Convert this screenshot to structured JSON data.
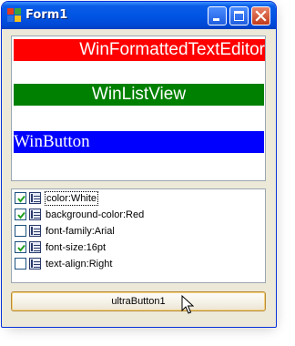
{
  "window": {
    "title": "Form1"
  },
  "preview": {
    "strips": [
      {
        "label": "WinFormattedTextEditor",
        "bg": "#ff0000",
        "fg": "#ffffff"
      },
      {
        "label": "WinListView",
        "bg": "#008000",
        "fg": "#ffffff"
      },
      {
        "label": "WinButton",
        "bg": "#0000ff",
        "fg": "#ffffff"
      }
    ]
  },
  "style_list": {
    "items": [
      {
        "label": "color:White",
        "checked": true
      },
      {
        "label": "background-color:Red",
        "checked": true
      },
      {
        "label": "font-family:Arial",
        "checked": false
      },
      {
        "label": "font-size:16pt",
        "checked": true
      },
      {
        "label": "text-align:Right",
        "checked": false
      }
    ]
  },
  "button": {
    "label": "ultraButton1"
  },
  "colors": {
    "titlebar": "#0054e3",
    "window_bg": "#ece9d8",
    "check": "#21a121"
  }
}
